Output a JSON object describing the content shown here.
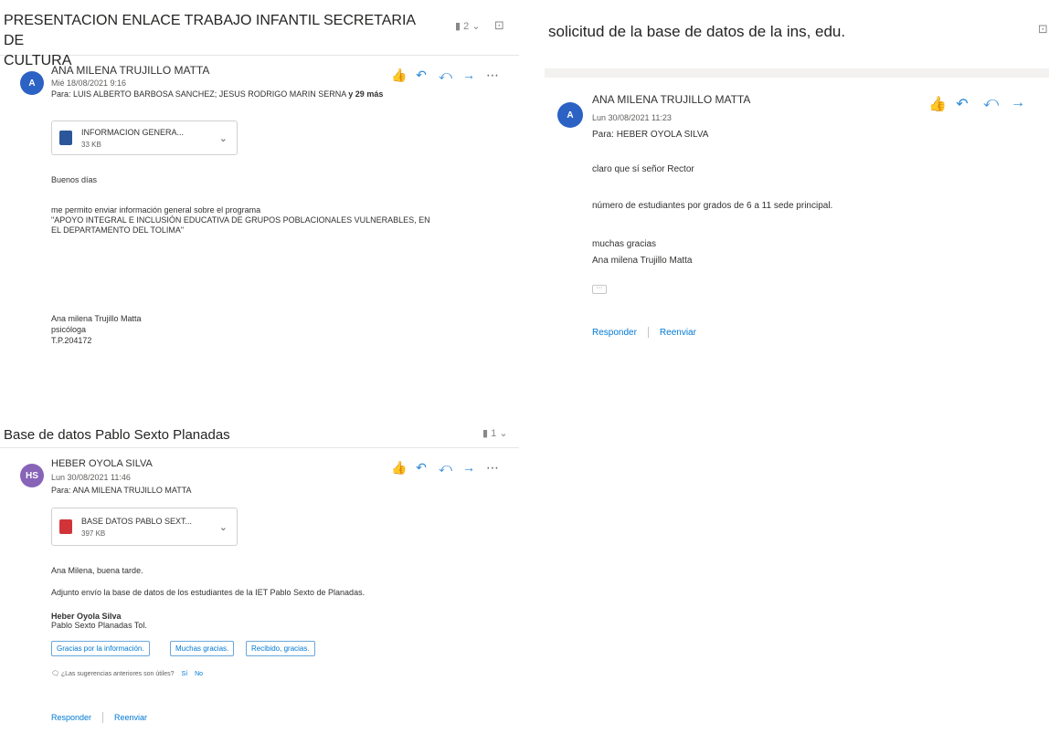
{
  "email1": {
    "subject_line1": "PRESENTACION ENLACE TRABAJO INFANTIL SECRETARIA DE",
    "subject_line2": "CULTURA",
    "thread_count": "2",
    "avatar_initials": "A",
    "avatar_color": "#2b62c4",
    "sender": "ANA MILENA TRUJILLO MATTA",
    "date": "Mié 18/08/2021 9:16",
    "to_prefix": "Para:",
    "to": "LUIS ALBERTO BARBOSA SANCHEZ; JESUS RODRIGO MARIN SERNA",
    "to_more": "y 29 más",
    "attachment": {
      "name": "INFORMACION GENERA...",
      "size": "33 KB",
      "type": "word-icon"
    },
    "body": [
      "Buenos días",
      "me permito enviar información general sobre el programa",
      "\"APOYO INTEGRAL E INCLUSIÓN EDUCATIVA DE GRUPOS POBLACIONALES VULNERABLES, EN",
      "EL DEPARTAMENTO DEL TOLIMA\"",
      "Ana milena Trujillo Matta",
      "psicóloga",
      "T.P.204172"
    ]
  },
  "email2": {
    "subject": "solicitud de la base de datos de la ins, edu.",
    "avatar_initials": "A",
    "avatar_color": "#2b62c4",
    "sender": "ANA MILENA TRUJILLO MATTA",
    "date": "Lun 30/08/2021 11:23",
    "to_prefix": "Para:",
    "to": "HEBER OYOLA SILVA",
    "body": [
      "claro que sí señor Rector",
      "número de estudiantes por grados de 6 a 11 sede principal.",
      "muchas gracias",
      "Ana milena Trujillo Matta"
    ],
    "reply": "Responder",
    "forward": "Reenviar"
  },
  "email3": {
    "subject": "Base de datos Pablo Sexto Planadas",
    "thread_count": "1",
    "avatar_initials": "HS",
    "avatar_color": "#8764b8",
    "sender": "HEBER OYOLA SILVA",
    "date": "Lun 30/08/2021 11:46",
    "to_prefix": "Para:",
    "to": "ANA MILENA TRUJILLO MATTA",
    "attachment": {
      "name": "BASE DATOS PABLO SEXT...",
      "size": "397 KB",
      "type": "pdf-icon"
    },
    "body": [
      "Ana Milena, buena tarde.",
      "Adjunto envío la base de datos de los estudiantes de la IET Pablo Sexto de Planadas.",
      "Heber Oyola Silva",
      "Pablo Sexto Planadas Tol."
    ],
    "suggestions": [
      "Gracias por la información.",
      "Muchas gracias.",
      "Recibido, gracias."
    ],
    "feedback": "¿Las sugerencias anteriores son útiles?",
    "feedback_yes": "Sí",
    "feedback_no": "No",
    "reply": "Responder",
    "forward": "Reenviar"
  }
}
